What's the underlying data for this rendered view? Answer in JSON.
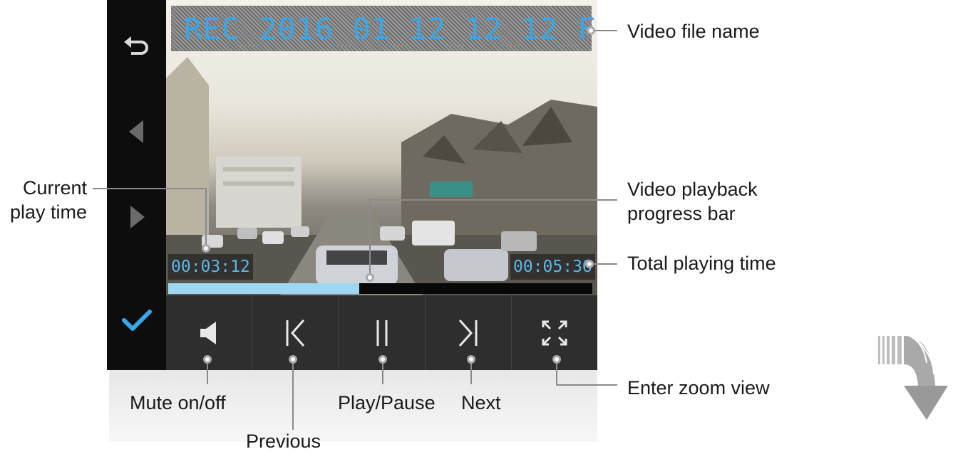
{
  "screen": {
    "file_name": "REC_2016_01_12_12_12_F",
    "current_time": "00:03:12",
    "total_time": "00:05:36",
    "progress": 0.45
  },
  "sidebar": {
    "back_icon": "back-icon",
    "prev_icon": "triangle-left-icon",
    "next_icon": "triangle-right-icon",
    "confirm_icon": "checkmark-icon"
  },
  "controls": {
    "mute_icon": "speaker-icon",
    "previous_icon": "skip-previous-icon",
    "play_pause_icon": "pause-icon",
    "next_icon": "skip-next-icon",
    "zoom_icon": "expand-icon"
  },
  "annotations": {
    "video_file_name": "Video file name",
    "current_play_time": "Current\nplay time",
    "video_playback_progress_bar": "Video playback\nprogress bar",
    "total_playing_time": "Total playing time",
    "mute_on_off": "Mute on/off",
    "previous": "Previous",
    "play_pause": "Play/Pause",
    "next": "Next",
    "enter_zoom_view": "Enter zoom view"
  },
  "colors": {
    "accent": "#3aa6e6",
    "progress_fill": "#9fd6f2",
    "sidebar_bg": "#0d0d0d",
    "controls_bg": "#2e2e2e"
  },
  "extra_icon": "scroll-down-arrow-icon"
}
